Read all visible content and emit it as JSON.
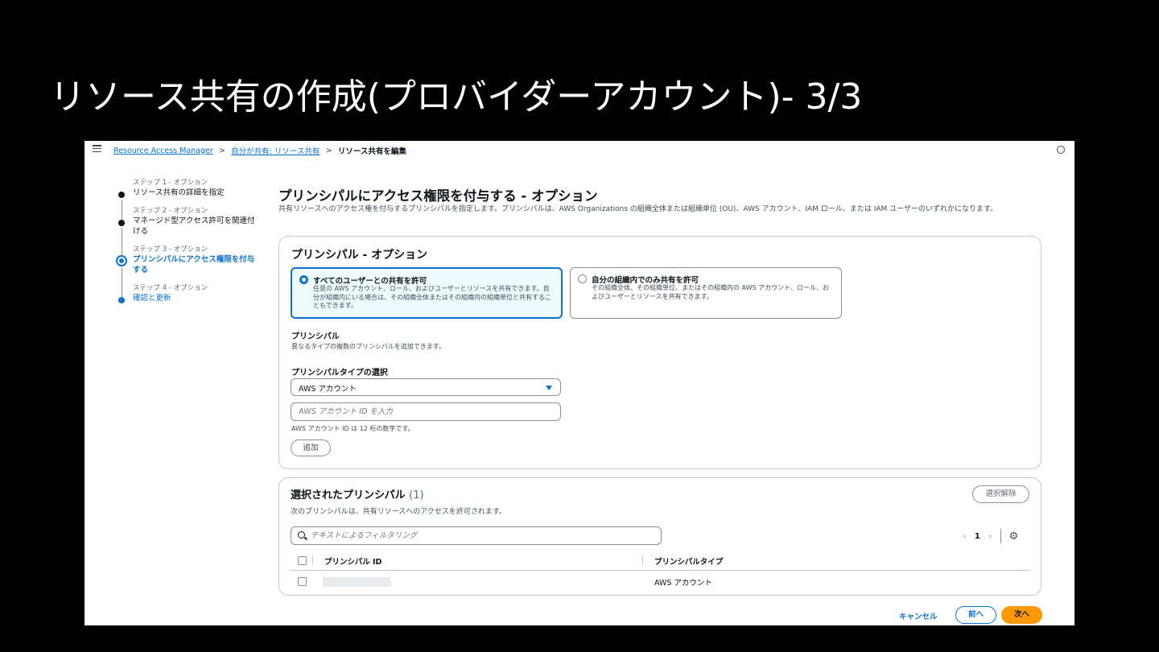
{
  "slide": {
    "title": "リソース共有の作成(プロバイダーアカウント)- 3/3"
  },
  "breadcrumb": {
    "items": [
      "Resource Access Manager",
      "自分が共有: リソース共有"
    ],
    "current": "リソース共有を編集",
    "separator": ">"
  },
  "steps": [
    {
      "label": "ステップ 1 - オプション",
      "title": "リソース共有の詳細を指定"
    },
    {
      "label": "ステップ 2 - オプション",
      "title": "マネージド型アクセス許可を関連付ける"
    },
    {
      "label": "ステップ 3 - オプション",
      "title": "プリンシパルにアクセス権限を付与する"
    },
    {
      "label": "ステップ 4 - オプション",
      "title": "確認と更新"
    }
  ],
  "main": {
    "heading": "プリンシパルにアクセス権限を付与する - オプション",
    "description": "共有リソースへのアクセス権を付与するプリンシパルを指定します。プリンシパルは、AWS Organizations の組織全体または組織単位 (OU)、AWS アカウント、IAM ロール、または IAM ユーザーのいずれかになります。"
  },
  "principals_panel": {
    "heading": "プリンシパル - オプション",
    "tiles": [
      {
        "title": "すべてのユーザーとの共有を許可",
        "description": "任意の AWS アカウント、ロール、およびユーザーとリソースを共有できます。自分が組織内にいる場合は、その組織全体またはその組織内の組織単位と共有することもできます。"
      },
      {
        "title": "自分の組織内でのみ共有を許可",
        "description": "その組織全体、その組織単位、またはその組織内の AWS アカウント、ロール、およびユーザーとリソースを共有できます。"
      }
    ],
    "principal_label": "プリンシパル",
    "principal_hint": "異なるタイプの複数のプリンシパルを追加できます。",
    "type_label": "プリンシパルタイプの選択",
    "type_value": "AWS アカウント",
    "account_placeholder": "AWS アカウント ID を入力",
    "account_hint": "AWS アカウント ID は 12 桁の数字です。",
    "add_label": "追加"
  },
  "selected_panel": {
    "heading": "選択されたプリンシパル",
    "count": "(1)",
    "description": "次のプリンシパルは、共有リソースへのアクセスを許可されます。",
    "clear_label": "選択解除",
    "filter_placeholder": "テキストによるフィルタリング",
    "page": "1",
    "columns": [
      "プリンシパル ID",
      "プリンシパルタイプ"
    ],
    "rows": [
      {
        "type": "AWS アカウント"
      }
    ]
  },
  "footer": {
    "cancel": "キャンセル",
    "prev": "前へ",
    "next": "次へ"
  },
  "colors": {
    "link": "#0972d3",
    "primary": "#ff9900",
    "text": "#0f141a"
  }
}
